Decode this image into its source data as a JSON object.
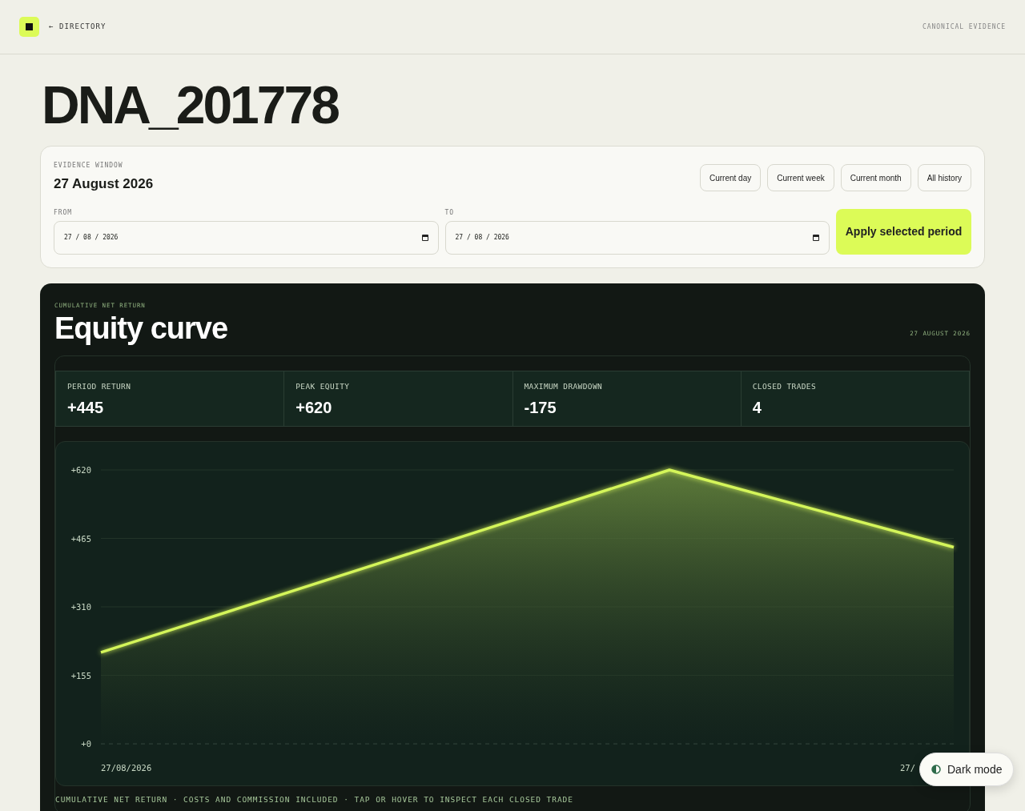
{
  "header": {
    "back_link": "← DIRECTORY",
    "tag": "CANONICAL EVIDENCE"
  },
  "title": "DNA_201778",
  "evidence_window": {
    "label": "EVIDENCE WINDOW",
    "date": "27 August 2026",
    "presets": [
      {
        "label": "Current day"
      },
      {
        "label": "Current week"
      },
      {
        "label": "Current month"
      },
      {
        "label": "All history"
      }
    ],
    "from": {
      "label": "FROM",
      "value": "27 / 08 / 2026"
    },
    "to": {
      "label": "TO",
      "value": "27 / 08 / 2026"
    },
    "apply_button": "Apply selected period"
  },
  "equity": {
    "eyebrow": "CUMULATIVE NET RETURN",
    "title": "Equity curve",
    "date": "27 AUGUST 2026",
    "stats": [
      {
        "label": "PERIOD RETURN",
        "value": "+445"
      },
      {
        "label": "PEAK EQUITY",
        "value": "+620"
      },
      {
        "label": "MAXIMUM DRAWDOWN",
        "value": "-175"
      },
      {
        "label": "CLOSED TRADES",
        "value": "4"
      }
    ],
    "chart_data": {
      "type": "area",
      "grid": true,
      "values": [
        207,
        413,
        620,
        445
      ],
      "ylim": [
        0,
        620
      ],
      "yticks": [
        {
          "value": 0,
          "label": "+0"
        },
        {
          "value": 155,
          "label": "+155"
        },
        {
          "value": 310,
          "label": "+310"
        },
        {
          "value": 465,
          "label": "+465"
        },
        {
          "value": 620,
          "label": "+620"
        }
      ],
      "annotations": [
        "27/08/2026",
        "27/"
      ]
    },
    "footnote": "CUMULATIVE NET RETURN · COSTS AND COMMISSION INCLUDED · TAP OR HOVER TO INSPECT EACH CLOSED TRADE"
  },
  "theme_toggle": "Dark mode"
}
